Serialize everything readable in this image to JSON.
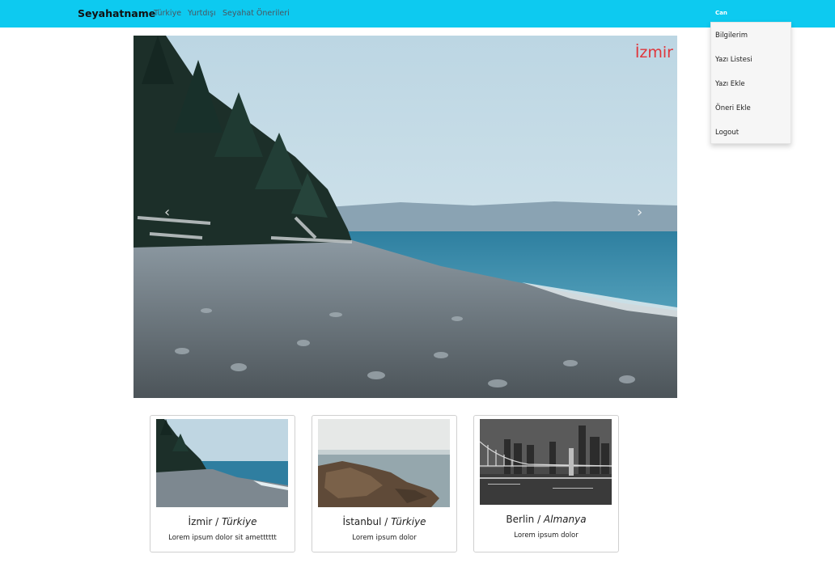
{
  "navbar": {
    "brand": "Seyahatname",
    "links": [
      "Türkiye",
      "Yurtdışı",
      "Seyahat Önerileri"
    ],
    "user": "Can",
    "background": "#0dcaf0"
  },
  "user_menu": {
    "items": [
      "Bilgilerim",
      "Yazı Listesi",
      "Yazı Ekle",
      "Öneri Ekle",
      "Logout"
    ]
  },
  "hero": {
    "caption": "İzmir",
    "caption_color": "#e0353b",
    "prev_icon": "chevron-left-icon",
    "next_icon": "chevron-right-icon",
    "prev_glyph": "‹",
    "next_glyph": "›"
  },
  "cards": [
    {
      "city": "İzmir",
      "country": "Türkiye",
      "text": "Lorem ipsum dolor sit ametttttt"
    },
    {
      "city": "İstanbul",
      "country": "Türkiye",
      "text": "Lorem ipsum dolor"
    },
    {
      "city": "Berlin",
      "country": "Almanya",
      "text": "Lorem ipsum dolor"
    }
  ]
}
